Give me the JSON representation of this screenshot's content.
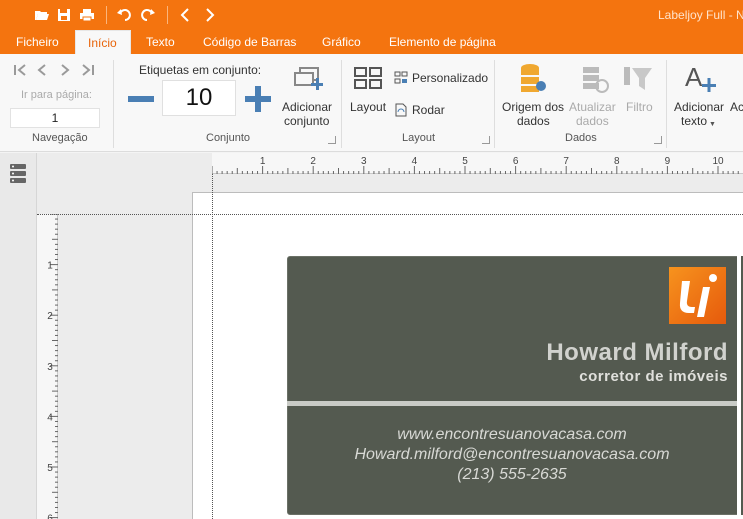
{
  "app": {
    "title": "Labeljoy Full - N"
  },
  "tabs": [
    {
      "label": "Ficheiro",
      "active": false
    },
    {
      "label": "Início",
      "active": true
    },
    {
      "label": "Texto",
      "active": false
    },
    {
      "label": "Código de Barras",
      "active": false
    },
    {
      "label": "Gráfico",
      "active": false
    },
    {
      "label": "Elemento de página",
      "active": false
    }
  ],
  "ribbon": {
    "navigation": {
      "goto_label": "Ir para página:",
      "page_value": "1",
      "group_label": "Navegação"
    },
    "set": {
      "labels_per_set_label": "Etiquetas em conjunto:",
      "count": "10",
      "add_set_line1": "Adicionar",
      "add_set_line2": "conjunto",
      "group_label": "Conjunto"
    },
    "layout": {
      "layout_label": "Layout",
      "custom_label": "Personalizado",
      "rotate_label": "Rodar",
      "group_label": "Layout"
    },
    "data": {
      "source_line1": "Origem dos",
      "source_line2": "dados",
      "refresh_line1": "Atualizar",
      "refresh_line2": "dados",
      "filter_label": "Filtro",
      "group_label": "Dados"
    },
    "text": {
      "add_text_line1": "Adicionar",
      "add_text_line2": "texto",
      "next_partial": "Ac"
    }
  },
  "rulers": {
    "horizontal": [
      "1",
      "2",
      "3",
      "4",
      "5",
      "6",
      "7",
      "8",
      "9",
      "10"
    ],
    "vertical": [
      "1",
      "2",
      "3",
      "4",
      "5",
      "6"
    ]
  },
  "label": {
    "name": "Howard Milford",
    "role": "corretor de imóveis",
    "website": "www.encontresuanovacasa.com",
    "email": "Howard.milford@encontresuanovacasa.com",
    "phone": "(213) 555-2635",
    "colors": {
      "background": "#545a50",
      "logo": "#f4740f",
      "accent": "#f4740f"
    }
  }
}
